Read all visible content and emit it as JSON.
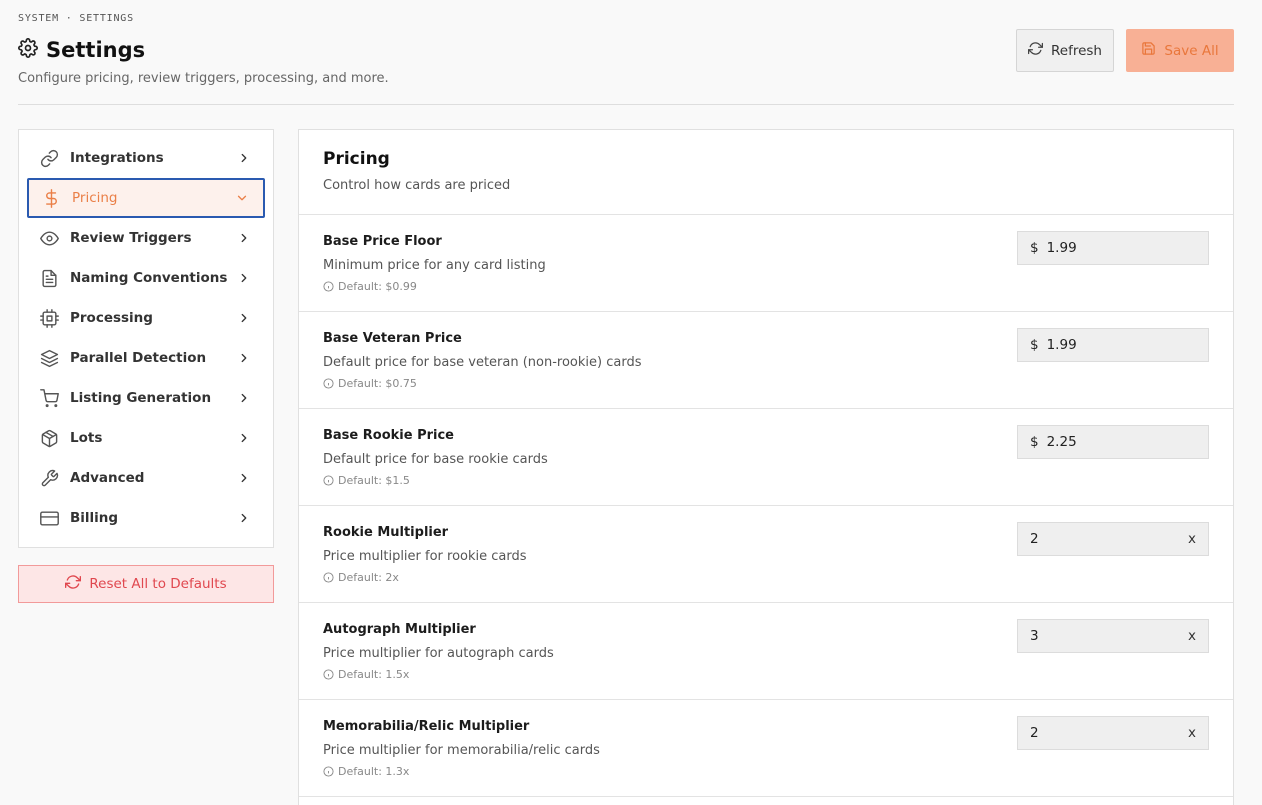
{
  "header": {
    "breadcrumb": "SYSTEM · SETTINGS",
    "title": "Settings",
    "subtitle": "Configure pricing, review triggers, processing, and more.",
    "refresh_label": "Refresh",
    "save_label": "Save All"
  },
  "sidebar": {
    "items": [
      {
        "label": "Integrations",
        "icon": "link-icon"
      },
      {
        "label": "Pricing",
        "icon": "dollar-icon",
        "active": true
      },
      {
        "label": "Review Triggers",
        "icon": "eye-icon"
      },
      {
        "label": "Naming Conventions",
        "icon": "document-icon"
      },
      {
        "label": "Processing",
        "icon": "cpu-icon"
      },
      {
        "label": "Parallel Detection",
        "icon": "layers-icon"
      },
      {
        "label": "Listing Generation",
        "icon": "cart-icon"
      },
      {
        "label": "Lots",
        "icon": "box-icon"
      },
      {
        "label": "Advanced",
        "icon": "wrench-icon"
      },
      {
        "label": "Billing",
        "icon": "card-icon"
      }
    ],
    "reset_label": "Reset All to Defaults"
  },
  "panel": {
    "title": "Pricing",
    "subtitle": "Control how cards are priced",
    "settings": [
      {
        "label": "Base Price Floor",
        "description": "Minimum price for any card listing",
        "default": "Default: $0.99",
        "prefix": "$",
        "value": "1.99",
        "suffix": ""
      },
      {
        "label": "Base Veteran Price",
        "description": "Default price for base veteran (non-rookie) cards",
        "default": "Default: $0.75",
        "prefix": "$",
        "value": "1.99",
        "suffix": ""
      },
      {
        "label": "Base Rookie Price",
        "description": "Default price for base rookie cards",
        "default": "Default: $1.5",
        "prefix": "$",
        "value": "2.25",
        "suffix": ""
      },
      {
        "label": "Rookie Multiplier",
        "description": "Price multiplier for rookie cards",
        "default": "Default: 2x",
        "prefix": "",
        "value": "2",
        "suffix": "x"
      },
      {
        "label": "Autograph Multiplier",
        "description": "Price multiplier for autograph cards",
        "default": "Default: 1.5x",
        "prefix": "",
        "value": "3",
        "suffix": "x"
      },
      {
        "label": "Memorabilia/Relic Multiplier",
        "description": "Price multiplier for memorabilia/relic cards",
        "default": "Default: 1.3x",
        "prefix": "",
        "value": "2",
        "suffix": "x"
      }
    ]
  },
  "colors": {
    "accent": "#ea7f47",
    "active_border": "#2a5ab0",
    "danger": "#e0484f"
  }
}
